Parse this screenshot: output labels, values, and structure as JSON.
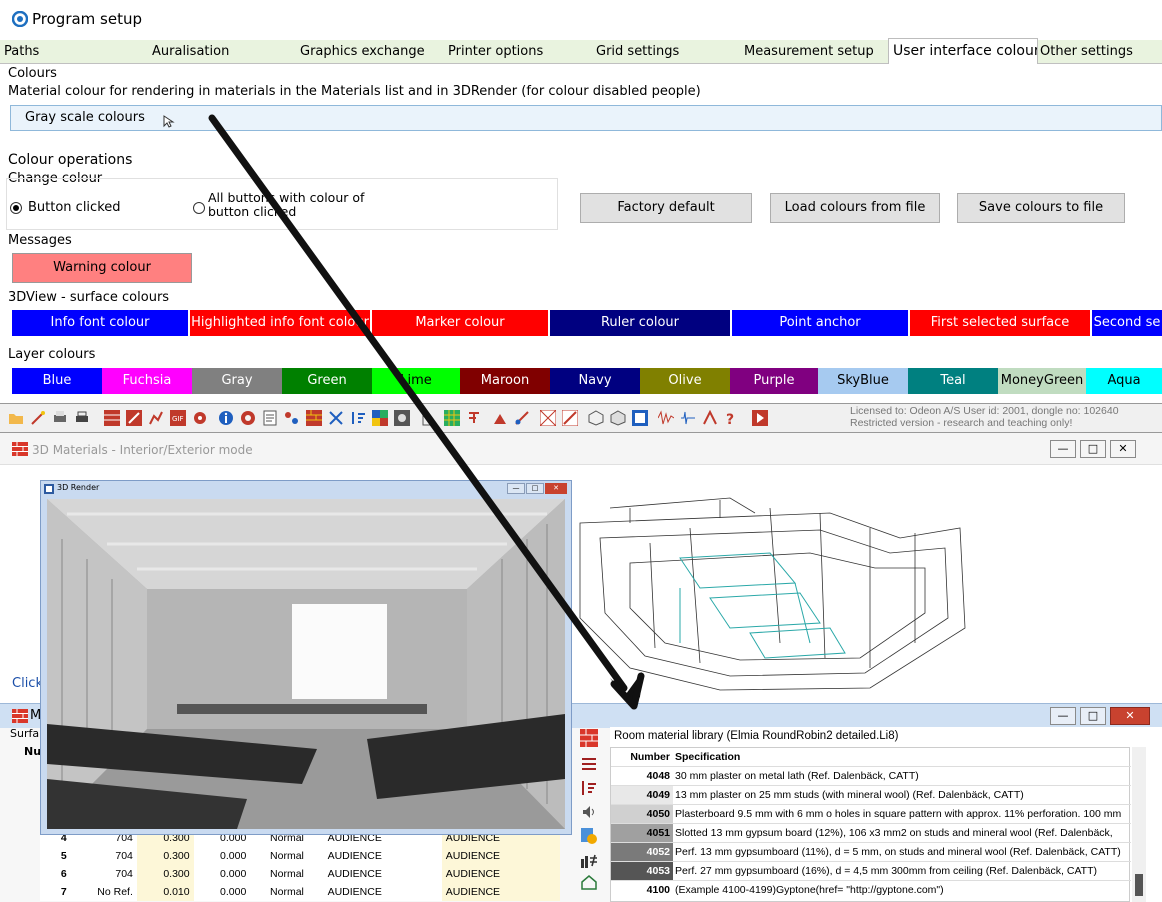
{
  "window": {
    "title": "Program setup"
  },
  "tabs": [
    "Paths",
    "Auralisation",
    "Graphics exchange",
    "Printer options",
    "Grid settings",
    "Measurement setup",
    "User interface colours",
    "Other settings"
  ],
  "colours_section": {
    "heading": "Colours",
    "description": "Material colour for rendering in materials in the Materials list and in 3DRender (for colour disabled people)",
    "dropdown_value": "Gray scale colours"
  },
  "colour_ops": {
    "heading": "Colour operations",
    "change_colour": "Change colour",
    "radio1": "Button clicked",
    "radio2_line1": "All buttons with colour of",
    "radio2_line2": "button clicked",
    "selected_radio": "Button clicked",
    "factory_default": "Factory default",
    "load": "Load colours from file",
    "save": "Save colours to file"
  },
  "messages": {
    "heading": "Messages",
    "warning": "Warning colour"
  },
  "surface": {
    "heading": "3DView - surface colours",
    "buttons": [
      {
        "label": "Info font colour",
        "bg": "#0000ff",
        "fg": "#ffffff"
      },
      {
        "label": "Highlighted info font colour",
        "bg": "#ff0000",
        "fg": "#ffffff"
      },
      {
        "label": "Marker colour",
        "bg": "#ff0000",
        "fg": "#ffffff"
      },
      {
        "label": "Ruler colour",
        "bg": "#000080",
        "fg": "#ffffff"
      },
      {
        "label": "Point anchor",
        "bg": "#0000ff",
        "fg": "#ffffff"
      },
      {
        "label": "First selected surface",
        "bg": "#ff0000",
        "fg": "#ffffff"
      },
      {
        "label": "Second se",
        "bg": "#0000ff",
        "fg": "#ffffff"
      }
    ]
  },
  "layers": {
    "heading": "Layer colours",
    "buttons": [
      {
        "label": "Blue",
        "bg": "#0000ff",
        "fg": "#ffffff"
      },
      {
        "label": "Fuchsia",
        "bg": "#ff00ff",
        "fg": "#ffffff"
      },
      {
        "label": "Gray",
        "bg": "#808080",
        "fg": "#ffffff"
      },
      {
        "label": "Green",
        "bg": "#008000",
        "fg": "#ffffff"
      },
      {
        "label": "Lime",
        "bg": "#00ff00",
        "fg": "#000000"
      },
      {
        "label": "Maroon",
        "bg": "#800000",
        "fg": "#ffffff"
      },
      {
        "label": "Navy",
        "bg": "#000080",
        "fg": "#ffffff"
      },
      {
        "label": "Olive",
        "bg": "#808000",
        "fg": "#ffffff"
      },
      {
        "label": "Purple",
        "bg": "#800080",
        "fg": "#ffffff"
      },
      {
        "label": "SkyBlue",
        "bg": "#a6caf0",
        "fg": "#000000"
      },
      {
        "label": "Teal",
        "bg": "#008080",
        "fg": "#ffffff"
      },
      {
        "label": "MoneyGreen",
        "bg": "#c0dcc0",
        "fg": "#000000"
      },
      {
        "label": "Aqua",
        "bg": "#00ffff",
        "fg": "#000000"
      }
    ]
  },
  "license": {
    "line1": "Licensed to: Odeon A/S   User id: 2001, dongle no: 102640",
    "line2": "Restricted version - research and teaching only!"
  },
  "mat3d": {
    "title": "3D Materials - Interior/Exterior mode",
    "click": "Click"
  },
  "render": {
    "title": "3D Render"
  },
  "matwin": {
    "m": "M",
    "surf": "Surfa",
    "nu": "Nu"
  },
  "library": {
    "title": "Room material library (Elmia RoundRobin2 detailed.Li8)",
    "col_number": "Number",
    "col_spec": "Specification",
    "rows": [
      {
        "n": "4048",
        "s": "30 mm plaster on metal lath (Ref. Dalenbäck, CATT)",
        "shade": "#ffffff"
      },
      {
        "n": "4049",
        "s": "13 mm plaster on 25 mm studs (with mineral wool) (Ref. Dalenbäck, CATT)",
        "shade": "#e8e8e8"
      },
      {
        "n": "4050",
        "s": "Plasterboard 9.5 mm with 6 mm o holes in square pattern with approx. 11% perforation. 100 mm",
        "shade": "#d0d0d0"
      },
      {
        "n": "4051",
        "s": "Slotted 13 mm gypsum board (12%), 106 x3 mm2 on studs and mineral wool (Ref. Dalenbäck,",
        "shade": "#a0a0a0"
      },
      {
        "n": "4052",
        "s": "Perf. 13 mm gypsumboard (11%), d = 5 mm, on studs and mineral wool (Ref. Dalenbäck, CATT)",
        "shade": "#7a7a7a"
      },
      {
        "n": "4053",
        "s": "Perf. 27 mm gypsumboard (16%), d = 4,5 mm 300mm from ceiling (Ref. Dalenbäck, CATT)",
        "shade": "#555555"
      },
      {
        "n": "4100",
        "s": "(Example 4100-4199)Gyptone(href= \"http://gyptone.com\")",
        "shade": "#ffffff"
      }
    ]
  },
  "surfaces": {
    "rows": [
      {
        "i": "4",
        "id": "704",
        "a": "0.300",
        "b": "0.000",
        "type": "Normal",
        "l1": "AUDIENCE",
        "l2": "AUDIENCE"
      },
      {
        "i": "5",
        "id": "704",
        "a": "0.300",
        "b": "0.000",
        "type": "Normal",
        "l1": "AUDIENCE",
        "l2": "AUDIENCE"
      },
      {
        "i": "6",
        "id": "704",
        "a": "0.300",
        "b": "0.000",
        "type": "Normal",
        "l1": "AUDIENCE",
        "l2": "AUDIENCE"
      },
      {
        "i": "7",
        "id": "No Ref.",
        "a": "0.010",
        "b": "0.000",
        "type": "Normal",
        "l1": "AUDIENCE",
        "l2": "AUDIENCE"
      }
    ]
  }
}
